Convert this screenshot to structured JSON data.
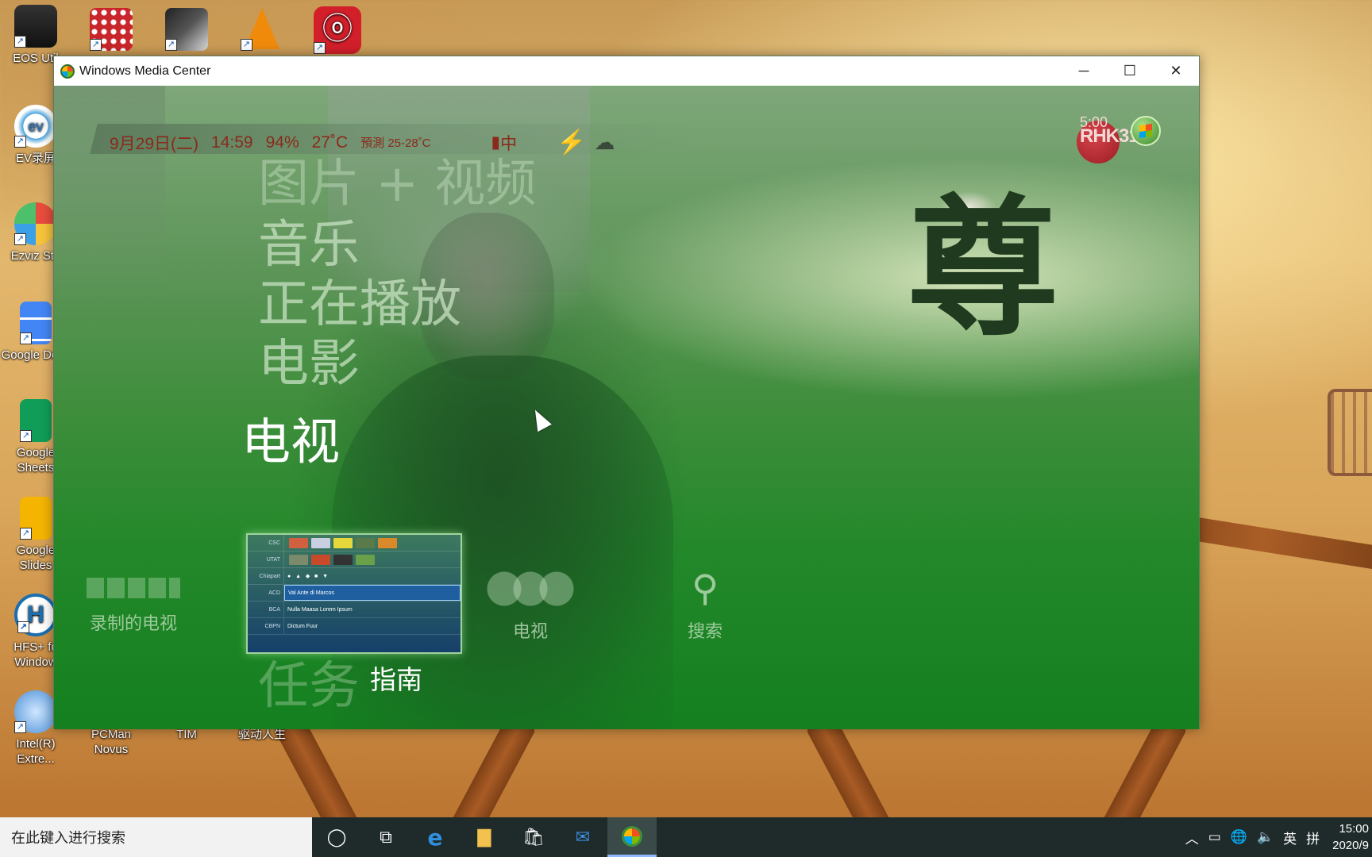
{
  "desktop": {
    "icons": [
      {
        "name": "desktop-icon-eos-utility",
        "label": "EOS Util"
      },
      {
        "name": "desktop-icon-app2",
        "label": ""
      },
      {
        "name": "desktop-icon-app3",
        "label": ""
      },
      {
        "name": "desktop-icon-vlc",
        "label": ""
      },
      {
        "name": "desktop-icon-netease-music",
        "label": ""
      },
      {
        "name": "desktop-icon-ev-recorder",
        "label": "EV录屏"
      },
      {
        "name": "desktop-icon-ezviz",
        "label": "Ezviz Stu"
      },
      {
        "name": "desktop-icon-google-docs",
        "label": "Google Docs"
      },
      {
        "name": "desktop-icon-google-sheets",
        "label": "Google Sheets"
      },
      {
        "name": "desktop-icon-google-slides",
        "label": "Google Slides"
      },
      {
        "name": "desktop-icon-hfs",
        "label": "HFS+ fo Window"
      },
      {
        "name": "desktop-icon-intel",
        "label": "Intel(R) Extre..."
      },
      {
        "name": "desktop-icon-pcman",
        "label": "PCMan Novus"
      },
      {
        "name": "desktop-icon-tim",
        "label": "TIM"
      },
      {
        "name": "desktop-icon-driver",
        "label": "驱动人生"
      }
    ]
  },
  "window": {
    "title": "Windows Media Center",
    "controls": {
      "minimize": "─",
      "maximize": "☐",
      "close": "✕"
    }
  },
  "status": {
    "date": "9月29日(二)",
    "time": "14:59",
    "humidity": "94%",
    "temperature": "27˚C",
    "forecast": "預測 25-28˚C",
    "signal": "中"
  },
  "channel_logo": {
    "text": "RHK31",
    "time": "5:00"
  },
  "program_glyph": "尊",
  "menu": {
    "items": [
      "图片 + 视频",
      "音乐",
      "正在播放",
      "电影",
      "电视",
      "任务"
    ],
    "selected": "电视"
  },
  "submenu": {
    "recorded": "录制的电视",
    "guide": "指南",
    "livetv": "电视",
    "search": "搜索"
  },
  "guide_tile": {
    "rows": [
      {
        "channel": "CSC",
        "program": ""
      },
      {
        "channel": "UTAT",
        "program": ""
      },
      {
        "channel": "Chiapart",
        "program": ""
      },
      {
        "channel": "ACD",
        "program": "Val Ante di Marcos"
      },
      {
        "channel": "BCA",
        "program": "Nulla Maasa     Lorem Ipsum"
      },
      {
        "channel": "CBPN",
        "program": "Dictum Fuur"
      }
    ]
  },
  "taskbar": {
    "search_placeholder": "在此键入进行搜索",
    "ime": "英",
    "ime2": "拼",
    "clock_time": "15:00",
    "clock_date": "2020/9"
  }
}
